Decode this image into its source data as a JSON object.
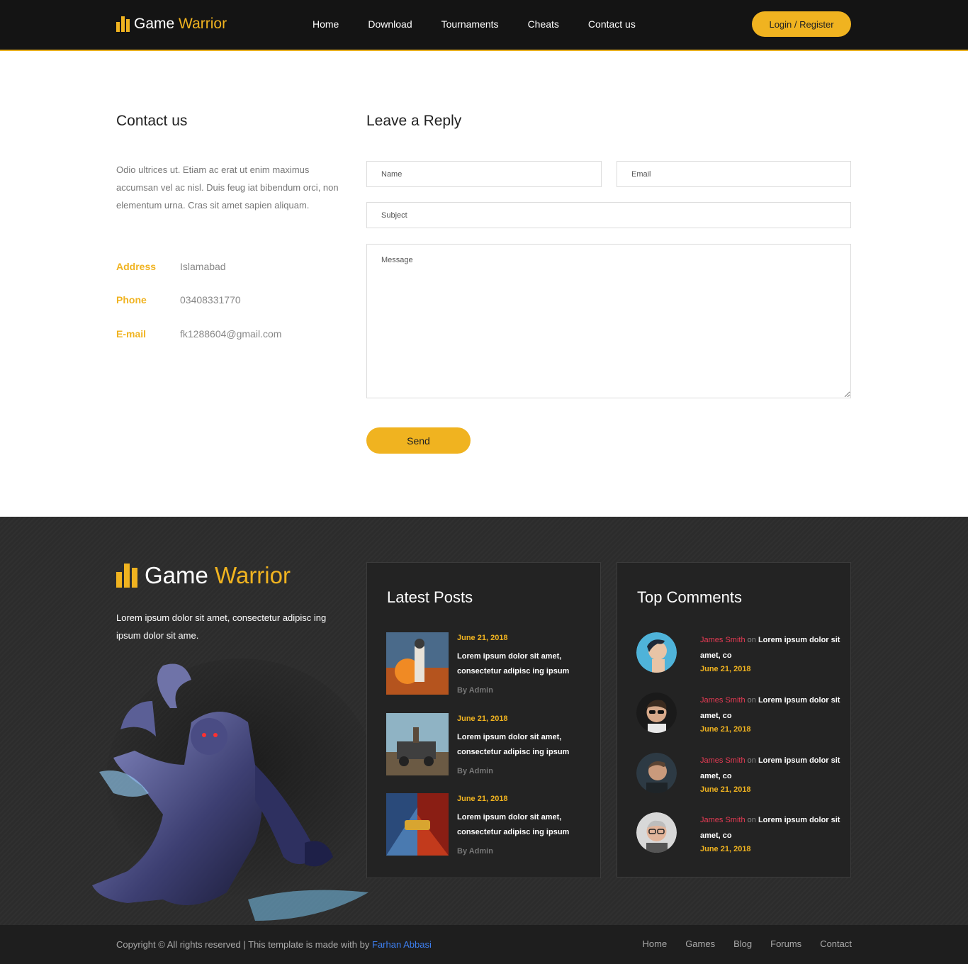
{
  "header": {
    "logo_word1": "Game",
    "logo_word2": "Warrior",
    "nav": [
      "Home",
      "Download",
      "Tournaments",
      "Cheats",
      "Contact us"
    ],
    "login_label": "Login / Register"
  },
  "contact": {
    "title": "Contact us",
    "description": "Odio ultrices ut. Etiam ac erat ut enim maximus accumsan vel ac nisl. Duis feug iat bibendum orci, non elementum urna. Cras sit amet sapien aliquam.",
    "info": [
      {
        "label": "Address",
        "value": "Islamabad"
      },
      {
        "label": "Phone",
        "value": "03408331770"
      },
      {
        "label": "E-mail",
        "value": "fk1288604@gmail.com"
      }
    ]
  },
  "reply": {
    "title": "Leave a Reply",
    "name_placeholder": "Name",
    "email_placeholder": "Email",
    "subject_placeholder": "Subject",
    "message_placeholder": "Message",
    "send_label": "Send"
  },
  "footer": {
    "logo_word1": "Game",
    "logo_word2": "Warrior",
    "description": "Lorem ipsum dolor sit amet, consectetur adipisc ing ipsum dolor sit ame.",
    "latest_posts_title": "Latest Posts",
    "posts": [
      {
        "date": "June 21, 2018",
        "text": "Lorem ipsum dolor sit amet, consectetur adipisc ing ipsum",
        "by": "By Admin"
      },
      {
        "date": "June 21, 2018",
        "text": "Lorem ipsum dolor sit amet, consectetur adipisc ing ipsum",
        "by": "By Admin"
      },
      {
        "date": "June 21, 2018",
        "text": "Lorem ipsum dolor sit amet, consectetur adipisc ing ipsum",
        "by": "By Admin"
      }
    ],
    "top_comments_title": "Top Comments",
    "comments": [
      {
        "author": "James Smith",
        "on": "on",
        "text": "Lorem ipsum dolor sit amet, co",
        "date": "June 21, 2018"
      },
      {
        "author": "James Smith",
        "on": "on",
        "text": "Lorem ipsum dolor sit amet, co",
        "date": "June 21, 2018"
      },
      {
        "author": "James Smith",
        "on": "on",
        "text": "Lorem ipsum dolor sit amet, co",
        "date": "June 21, 2018"
      },
      {
        "author": "James Smith",
        "on": "on",
        "text": "Lorem ipsum dolor sit amet, co",
        "date": "June 21, 2018"
      }
    ],
    "copyright_text": "Copyright © All rights reserved | This template is made with by",
    "copyright_author": "Farhan Abbasi",
    "bottom_nav": [
      "Home",
      "Games",
      "Blog",
      "Forums",
      "Contact"
    ]
  },
  "colors": {
    "accent": "#f0b320",
    "header_bg": "#141414",
    "footer_bg": "#2c2c2c",
    "comment_author": "#e63b54",
    "link": "#3d7ff0"
  },
  "icons": [
    "logo-bars-icon"
  ]
}
